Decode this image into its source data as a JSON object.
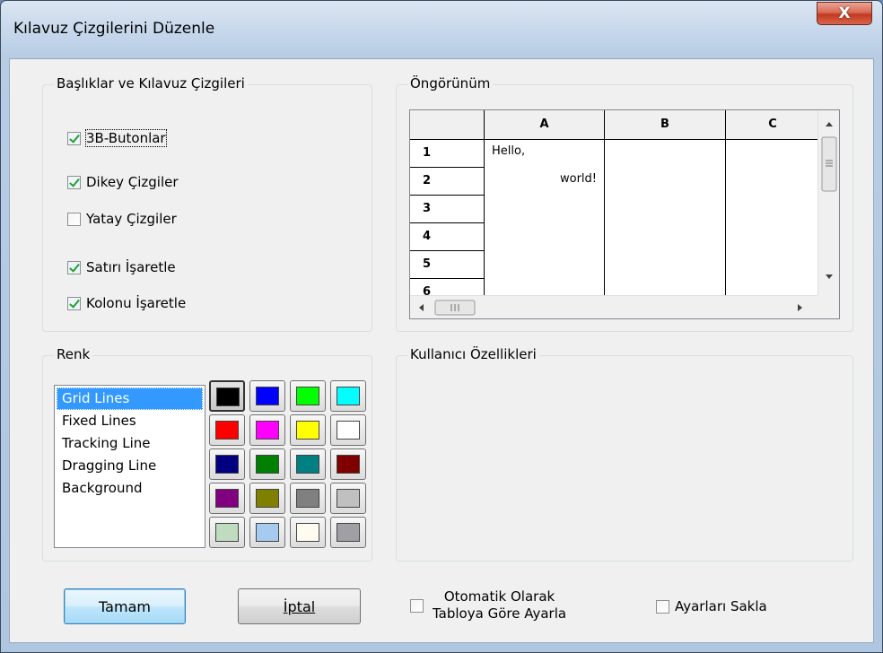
{
  "window": {
    "title": "Kılavuz Çizgilerini Düzenle",
    "close_glyph": "X"
  },
  "groups": {
    "headers_title": "Başlıklar ve Kılavuz Çizgileri",
    "preview_title": "Öngörünüm",
    "color_title": "Renk",
    "user_title": "Kullanıcı Özellikleri"
  },
  "checkboxes": [
    {
      "label": "3B-Butonlar",
      "checked": true
    },
    {
      "label": "Dikey Çizgiler",
      "checked": true
    },
    {
      "label": "Yatay Çizgiler",
      "checked": false
    },
    {
      "label": "Satırı İşaretle",
      "checked": true
    },
    {
      "label": "Kolonu İşaretle",
      "checked": true
    }
  ],
  "preview": {
    "columns": [
      "A",
      "B",
      "C"
    ],
    "rows": [
      "1",
      "2",
      "3",
      "4",
      "5",
      "6"
    ],
    "cell_a1": "Hello,",
    "cell_a2": "world!"
  },
  "color_list": {
    "items": [
      "Grid Lines",
      "Fixed Lines",
      "Tracking Line",
      "Dragging Line",
      "Background"
    ],
    "selected": "Grid Lines"
  },
  "swatches": [
    "#000000",
    "#0000ff",
    "#00ff00",
    "#00ffff",
    "#ff0000",
    "#ff00ff",
    "#ffff00",
    "#ffffff",
    "#000080",
    "#008000",
    "#008080",
    "#800000",
    "#800080",
    "#808000",
    "#808080",
    "#c0c0c0",
    "#c0dcc0",
    "#a6caf0",
    "#fffbf0",
    "#a0a0a4"
  ],
  "buttons": {
    "ok": "Tamam",
    "cancel": "İptal"
  },
  "options": {
    "auto_adjust_line1": "Otomatik Olarak",
    "auto_adjust_line2": "Tabloya Göre Ayarla",
    "auto_adjust_checked": false,
    "save_settings": "Ayarları Sakla",
    "save_settings_checked": false
  }
}
